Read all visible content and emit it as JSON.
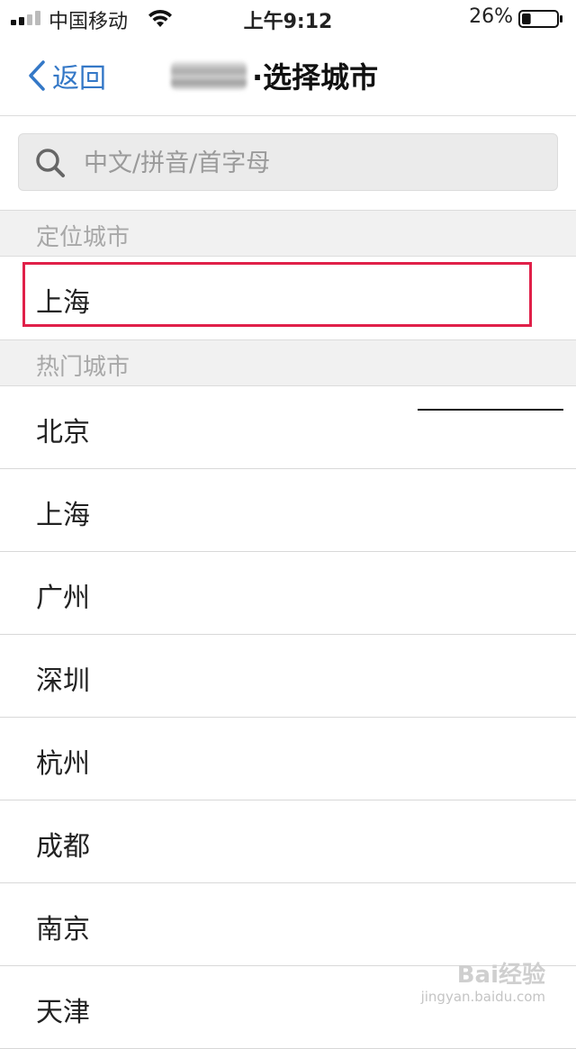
{
  "status_bar": {
    "carrier": "中国移动",
    "time": "上午9:12",
    "battery_percent": "26%",
    "battery_level": 0.26,
    "icons": [
      "signal-icon",
      "wifi-icon",
      "battery-icon"
    ]
  },
  "nav": {
    "back_label": "返回",
    "title": "·选择城市",
    "accent_color": "#3478c7"
  },
  "search": {
    "placeholder": "中文/拼音/首字母",
    "value": ""
  },
  "located": {
    "header": "定位城市",
    "city": "上海",
    "highlight_color": "#e02049"
  },
  "hot": {
    "header": "热门城市",
    "cities": [
      "北京",
      "上海",
      "广州",
      "深圳",
      "杭州",
      "成都",
      "南京",
      "天津"
    ]
  },
  "watermark": {
    "brand": "Bai经验",
    "url": "jingyan.baidu.com"
  }
}
